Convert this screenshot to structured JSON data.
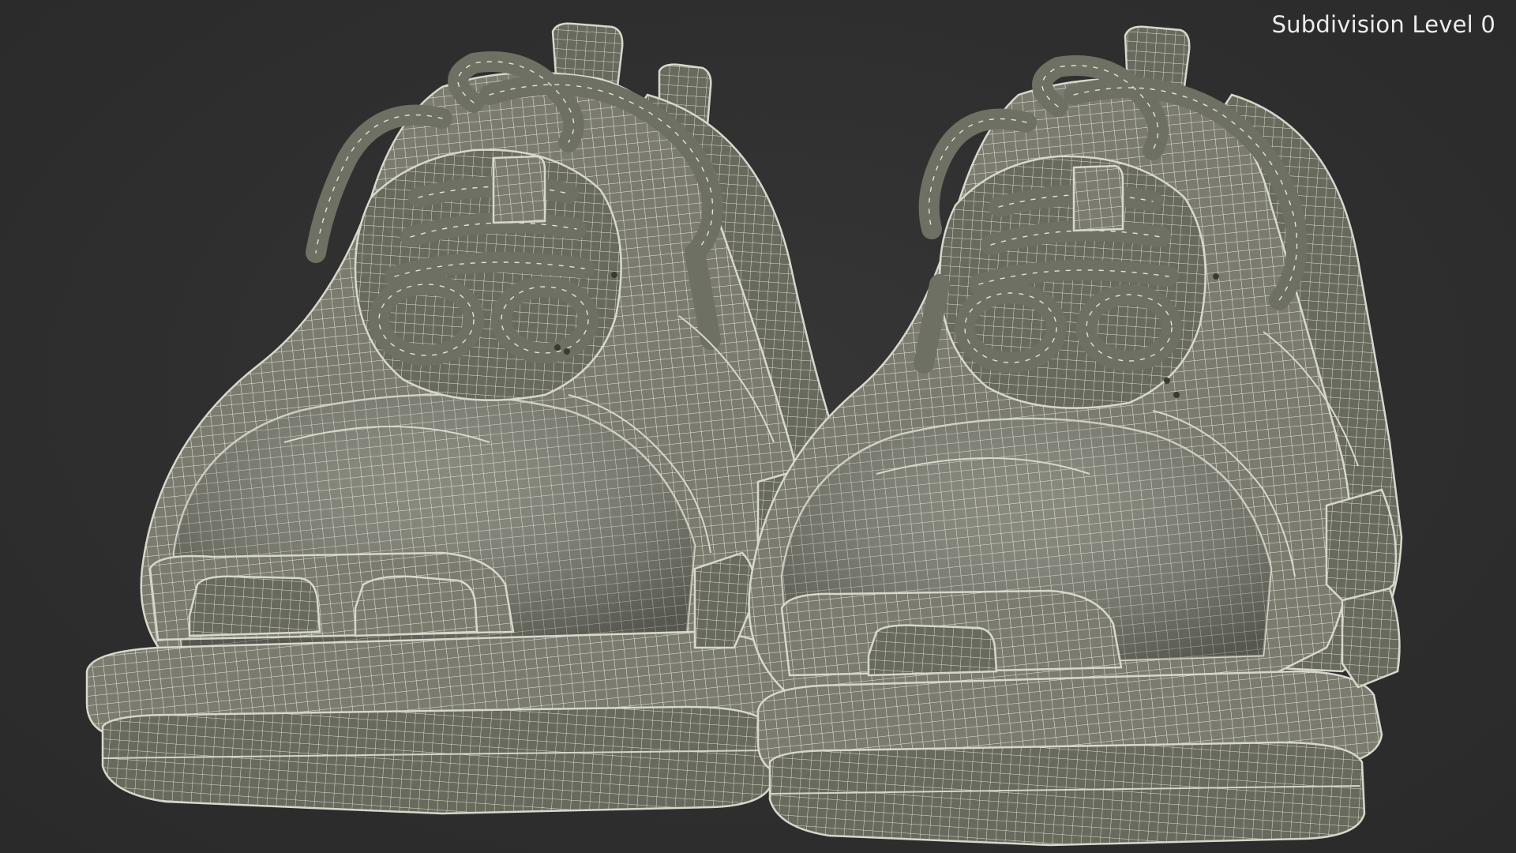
{
  "viewport": {
    "label": "Subdivision Level 0",
    "background_color": "#2e2e2e",
    "model_color": "#7a7b6e",
    "wire_color": "#e6e5da"
  },
  "models": [
    {
      "name": "left-sneaker"
    },
    {
      "name": "right-sneaker"
    }
  ]
}
